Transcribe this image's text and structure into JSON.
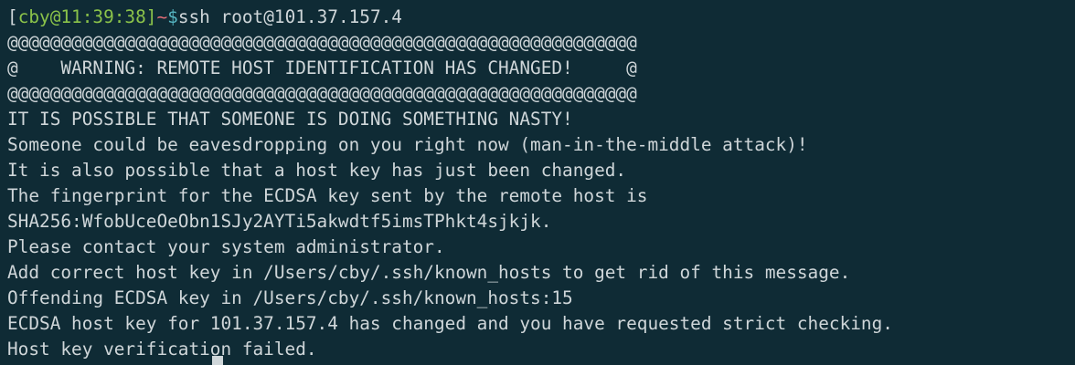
{
  "prompt": {
    "open_bracket": "[",
    "user_host": "cby@11:39:38]",
    "tilde": "~",
    "dollar": "$",
    "command": "ssh root@101.37.157.4"
  },
  "output_lines": [
    "@@@@@@@@@@@@@@@@@@@@@@@@@@@@@@@@@@@@@@@@@@@@@@@@@@@@@@@@@@@",
    "@    WARNING: REMOTE HOST IDENTIFICATION HAS CHANGED!     @",
    "@@@@@@@@@@@@@@@@@@@@@@@@@@@@@@@@@@@@@@@@@@@@@@@@@@@@@@@@@@@",
    "IT IS POSSIBLE THAT SOMEONE IS DOING SOMETHING NASTY!",
    "Someone could be eavesdropping on you right now (man-in-the-middle attack)!",
    "It is also possible that a host key has just been changed.",
    "The fingerprint for the ECDSA key sent by the remote host is",
    "SHA256:WfobUceOeObn1SJy2AYTi5akwdtf5imsTPhkt4sjkjk.",
    "Please contact your system administrator.",
    "Add correct host key in /Users/cby/.ssh/known_hosts to get rid of this message.",
    "Offending ECDSA key in /Users/cby/.ssh/known_hosts:15",
    "ECDSA host key for 101.37.157.4 has changed and you have requested strict checking.",
    "Host key verification failed."
  ],
  "colors": {
    "background": "#0f2b35",
    "text": "#cfd6d9",
    "prompt_user": "#8bc34a",
    "prompt_tilde": "#e06c75",
    "prompt_dollar": "#56b6c2"
  }
}
